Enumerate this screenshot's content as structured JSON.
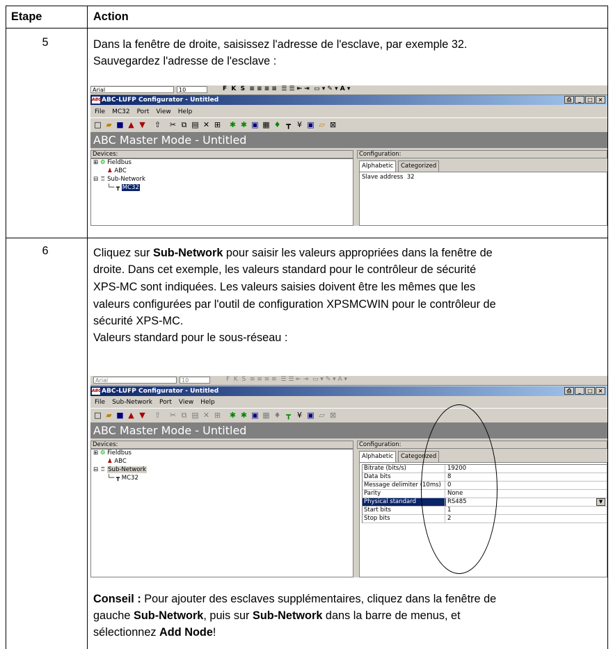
{
  "table": {
    "headers": {
      "step": "Etape",
      "action": "Action"
    },
    "rows": [
      {
        "step": "5",
        "text_lines": [
          "Dans la fenêtre de droite, saisissez l'adresse de l'esclave, par exemple 32.",
          "Sauvegardez l'adresse de l'esclave :"
        ]
      },
      {
        "step": "6",
        "text_lines": [
          "droite. Dans cet exemple, les valeurs standard pour le contrôleur de sécurité",
          "XPS-MC sont indiquées. Les valeurs saisies doivent être les mêmes que les",
          "valeurs configurées par l'outil de configuration XPSMCWIN pour le contrôleur de",
          "sécurité XPS-MC.",
          "Valeurs standard pour le sous-réseau :"
        ],
        "line1": {
          "pre": "Cliquez sur ",
          "bold": "Sub-Network",
          "post": " pour saisir les valeurs appropriées dans la fenêtre de"
        },
        "tip": {
          "label": "Conseil :",
          "part1": " Pour ajouter des esclaves supplémentaires, cliquez dans la fenêtre de",
          "part2": "gauche ",
          "bold2": "Sub-Network",
          "part3": ", puis sur ",
          "bold3": "Sub-Network",
          "part4": " dans la barre de menus, et",
          "part5": "sélectionnez ",
          "bold5": "Add Node",
          "part6": "!"
        }
      }
    ]
  },
  "screenshot1": {
    "word_font": "Arial",
    "word_size": "10",
    "app_title": "ABC-LUFP Configurator - Untitled",
    "logo": "ABC",
    "menu": [
      "File",
      "MC32",
      "Port",
      "View",
      "Help"
    ],
    "mode_title": "ABC Master Mode - Untitled",
    "devices_label": "Devices:",
    "config_label": "Configuration:",
    "tree": [
      "Fieldbus",
      "ABC",
      "Sub-Network",
      "MC32"
    ],
    "tabs": [
      "Alphabetic",
      "Categorized"
    ],
    "prop_key": "Slave address",
    "prop_value": "32"
  },
  "screenshot2": {
    "word_font": "Arial",
    "word_size": "10",
    "app_title": "ABC-LUFP Configurator - Untitled",
    "logo": "ABC",
    "menu": [
      "File",
      "Sub-Network",
      "Port",
      "View",
      "Help"
    ],
    "mode_title": "ABC Master Mode - Untitled",
    "devices_label": "Devices:",
    "config_label": "Configuration:",
    "tree": [
      "Fieldbus",
      "ABC",
      "Sub-Network",
      "MC32"
    ],
    "tabs": [
      "Alphabetic",
      "Categorized"
    ],
    "properties": [
      {
        "key": "Bitrate (bits/s)",
        "value": "19200"
      },
      {
        "key": "Data bits",
        "value": "8"
      },
      {
        "key": "Message delimiter (10ms)",
        "value": "0"
      },
      {
        "key": "Parity",
        "value": "None"
      },
      {
        "key": "Physical standard",
        "value": "RS485"
      },
      {
        "key": "Start bits",
        "value": "1"
      },
      {
        "key": "Stop bits",
        "value": "2"
      }
    ]
  }
}
